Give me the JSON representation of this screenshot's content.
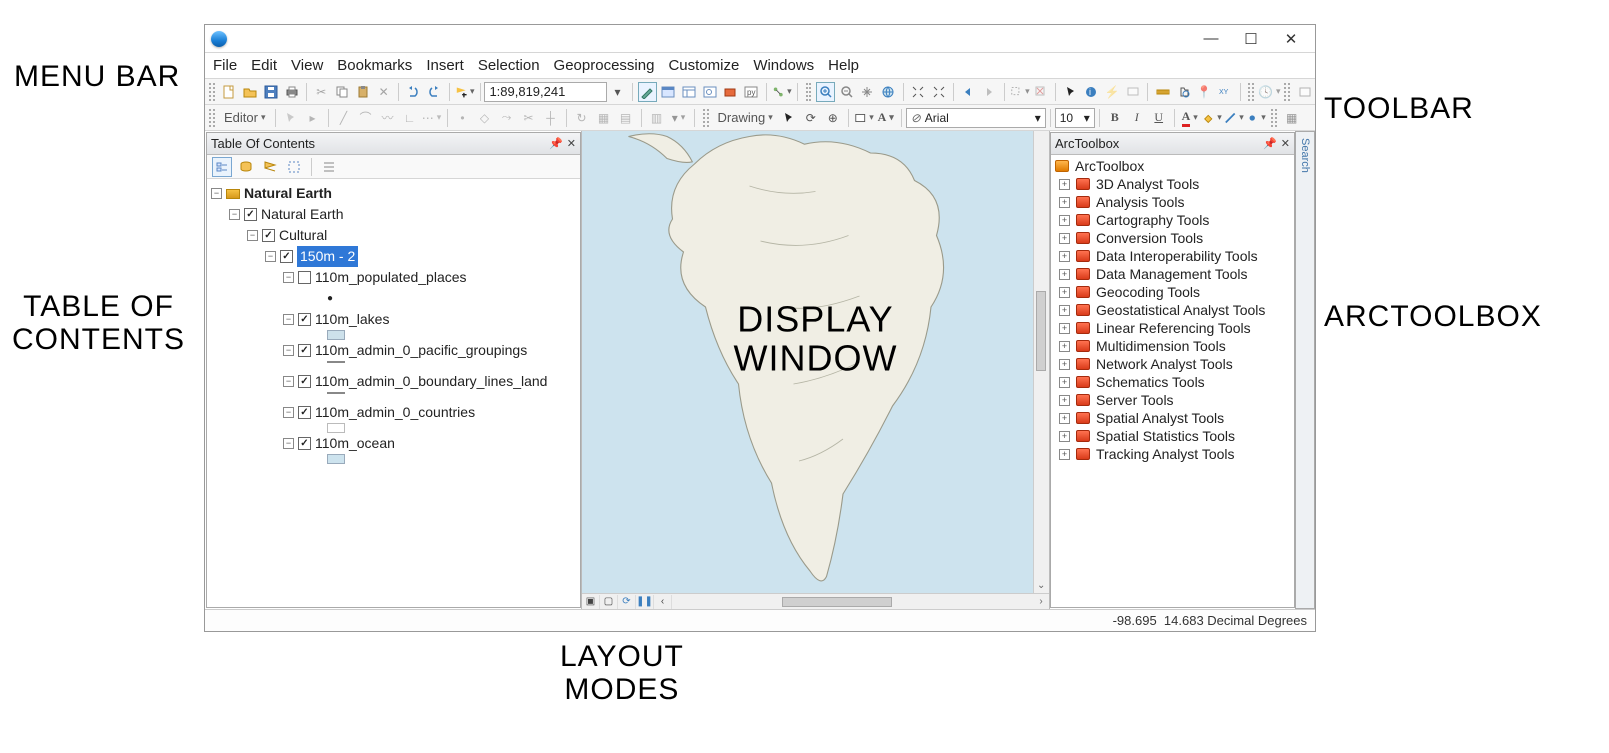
{
  "annotations": {
    "menubar": "MENU BAR",
    "toolbar": "TOOLBAR",
    "toc": "TABLE OF\nCONTENTS",
    "arctoolbox": "ARCTOOLBOX",
    "display": "DISPLAY\nWINDOW",
    "layout": "LAYOUT\nMODES"
  },
  "menu": [
    "File",
    "Edit",
    "View",
    "Bookmarks",
    "Insert",
    "Selection",
    "Geoprocessing",
    "Customize",
    "Windows",
    "Help"
  ],
  "toolbar1": {
    "scale": "1:89,819,241"
  },
  "toolbar2": {
    "editor": "Editor",
    "drawing": "Drawing",
    "font": "Arial",
    "size": "10",
    "bold": "B",
    "italic": "I",
    "underline": "U"
  },
  "toc": {
    "title": "Table Of Contents",
    "root": "Natural Earth",
    "frame": "Natural Earth",
    "group": "Cultural",
    "sel": "150m - 2",
    "layers": [
      {
        "name": "110m_populated_places",
        "chk": false,
        "swatch": "point"
      },
      {
        "name": "110m_lakes",
        "chk": true,
        "swatch": "#cde1eb"
      },
      {
        "name": "110m_admin_0_pacific_groupings",
        "chk": true,
        "swatch": "line"
      },
      {
        "name": "110m_admin_0_boundary_lines_land",
        "chk": true,
        "swatch": "line"
      },
      {
        "name": "110m_admin_0_countries",
        "chk": true,
        "swatch": "none"
      },
      {
        "name": "110m_ocean",
        "chk": true,
        "swatch": "#cde3ee"
      }
    ]
  },
  "arctoolbox": {
    "title": "ArcToolbox",
    "root": "ArcToolbox",
    "items": [
      "3D Analyst Tools",
      "Analysis Tools",
      "Cartography Tools",
      "Conversion Tools",
      "Data Interoperability Tools",
      "Data Management Tools",
      "Geocoding Tools",
      "Geostatistical Analyst Tools",
      "Linear Referencing Tools",
      "Multidimension Tools",
      "Network Analyst Tools",
      "Schematics Tools",
      "Server Tools",
      "Spatial Analyst Tools",
      "Spatial Statistics Tools",
      "Tracking Analyst Tools"
    ]
  },
  "search_tab": "Search",
  "status": {
    "x": "-98.695",
    "y": "14.683",
    "units": "Decimal Degrees"
  }
}
